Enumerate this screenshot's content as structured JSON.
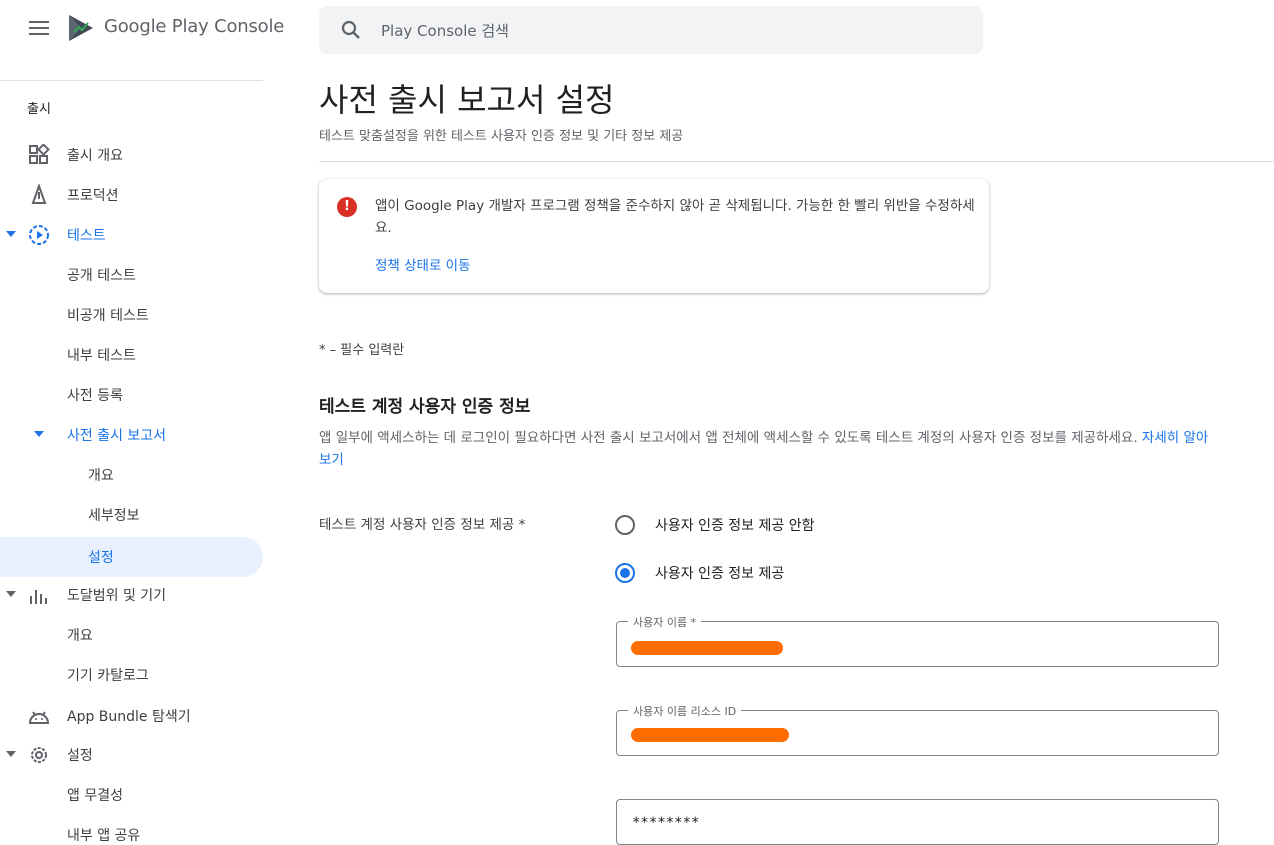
{
  "app": {
    "brand_name": "Google Play",
    "brand_suffix": "Console"
  },
  "search": {
    "placeholder": "Play Console 검색"
  },
  "sidebar": {
    "heading": "출시",
    "items": [
      {
        "label": "출시 개요",
        "icon": "dashboard-icon"
      },
      {
        "label": "프로덕션",
        "icon": "production-icon"
      },
      {
        "label": "테스트",
        "icon": "testing-icon"
      },
      {
        "label": "공개 테스트"
      },
      {
        "label": "비공개 테스트"
      },
      {
        "label": "내부 테스트"
      },
      {
        "label": "사전 등록"
      },
      {
        "label": "사전 출시 보고서"
      },
      {
        "label": "개요"
      },
      {
        "label": "세부정보"
      },
      {
        "label": "설정"
      },
      {
        "label": "도달범위 및 기기",
        "icon": "bar-chart-icon"
      },
      {
        "label": "개요"
      },
      {
        "label": "기기 카탈로그"
      },
      {
        "label": "App Bundle 탐색기",
        "icon": "android-icon"
      },
      {
        "label": "설정",
        "icon": "gear-icon"
      },
      {
        "label": "앱 무결성"
      },
      {
        "label": "내부 앱 공유"
      }
    ]
  },
  "main": {
    "title": "사전 출시 보고서 설정",
    "subtitle": "테스트 맞춤설정을 위한 테스트 사용자 인증 정보 및 기타 정보 제공",
    "alert": {
      "message": "앱이 Google Play 개발자 프로그램 정책을 준수하지 않아 곧 삭제됩니다. 가능한 한 빨리 위반을 수정하세요.",
      "link": "정책 상태로 이동"
    },
    "required_note": "* – 필수 입력란",
    "section": {
      "title": "테스트 계정 사용자 인증 정보",
      "description": "앱 일부에 액세스하는 데 로그인이 필요하다면 사전 출시 보고서에서 앱 전체에 액세스할 수 있도록 테스트 계정의 사용자 인증 정보를 제공하세요.",
      "learn_more": "자세히 알아보기"
    },
    "form": {
      "field_label": "테스트 계정 사용자 인증 정보 제공 *",
      "options": [
        {
          "label": "사용자 인증 정보 제공 안함",
          "checked": false
        },
        {
          "label": "사용자 인증 정보 제공",
          "checked": true
        }
      ],
      "username_label": "사용자 이름 *",
      "resource_id_label": "사용자 이름 리소스 ID",
      "password_value": "********"
    }
  },
  "colors": {
    "accent": "#1a73e8",
    "error": "#d93025",
    "redaction": "#ff6d00"
  }
}
